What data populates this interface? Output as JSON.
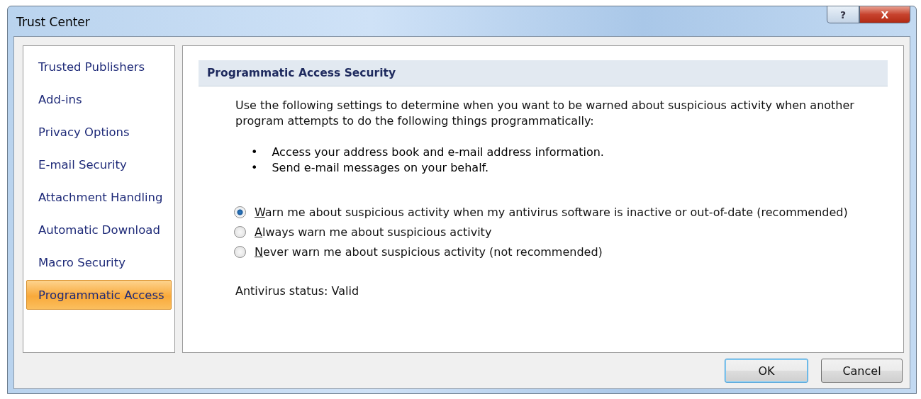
{
  "window": {
    "title": "Trust Center",
    "help_button": "?",
    "close_button": "X"
  },
  "sidebar": {
    "items": [
      {
        "label": "Trusted Publishers",
        "selected": false
      },
      {
        "label": "Add-ins",
        "selected": false
      },
      {
        "label": "Privacy Options",
        "selected": false
      },
      {
        "label": "E-mail Security",
        "selected": false
      },
      {
        "label": "Attachment Handling",
        "selected": false
      },
      {
        "label": "Automatic Download",
        "selected": false
      },
      {
        "label": "Macro Security",
        "selected": false
      },
      {
        "label": "Programmatic Access",
        "selected": true
      }
    ]
  },
  "section": {
    "title": "Programmatic Access Security",
    "intro": "Use the following settings to determine when you want to be warned about suspicious activity when another program attempts to do the following things programmatically:",
    "bullets": [
      {
        "marker": "•",
        "text": "Access your address book and e-mail address information."
      },
      {
        "marker": "•",
        "text": "Send e-mail messages on your behalf."
      }
    ],
    "options": [
      {
        "label": "Warn me about suspicious activity when my antivirus software is inactive or out-of-date (recommended)",
        "selected": true
      },
      {
        "label": "Always warn me about suspicious activity",
        "selected": false
      },
      {
        "label": "Never warn me about suspicious activity (not recommended)",
        "selected": false
      }
    ],
    "status": "Antivirus status: Valid"
  },
  "buttons": [
    {
      "label": "OK",
      "default": true
    },
    {
      "label": "Cancel",
      "default": false
    }
  ]
}
